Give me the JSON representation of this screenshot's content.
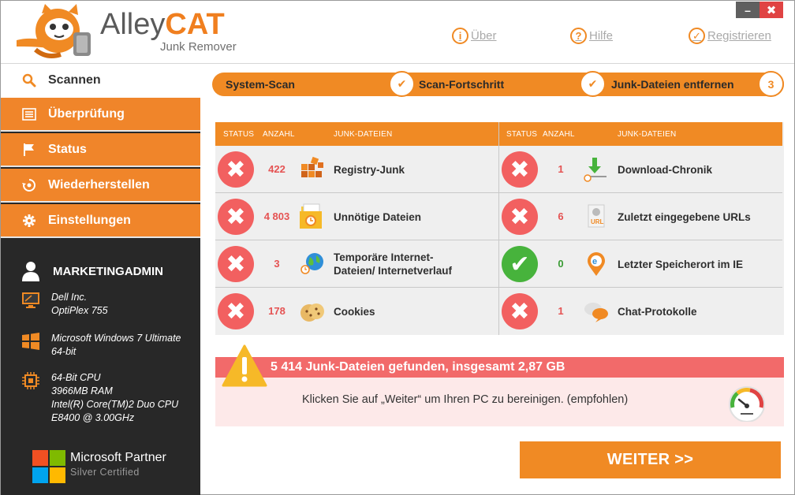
{
  "app": {
    "brand_part1": "Alley",
    "brand_part2": "CAT",
    "subtitle": "Junk Remover"
  },
  "header_links": {
    "about": "Über",
    "help": "Hilfe",
    "register": "Registrieren"
  },
  "window_controls": {
    "minimize": "–",
    "close": "✖"
  },
  "sidebar": {
    "items": [
      {
        "label": "Scannen",
        "icon": "search-icon",
        "active": true
      },
      {
        "label": "Überprüfung",
        "icon": "list-icon",
        "active": false
      },
      {
        "label": "Status",
        "icon": "flag-icon",
        "active": false
      },
      {
        "label": "Wiederherstellen",
        "icon": "restore-icon",
        "active": false
      },
      {
        "label": "Einstellungen",
        "icon": "gear-icon",
        "active": false
      }
    ],
    "user": "MARKETINGADMIN",
    "system": {
      "pc_line1": "Dell Inc.",
      "pc_line2": "OptiPlex 755",
      "os_line1": "Microsoft Windows 7 Ultimate",
      "os_line2": "64-bit",
      "cpu_line1": "64-Bit CPU",
      "cpu_line2": "3966MB RAM",
      "cpu_line3": "Intel(R) Core(TM)2 Duo CPU",
      "cpu_line4": "E8400  @ 3.00GHz"
    },
    "partner": {
      "title": "Microsoft Partner",
      "sub": "Silver Certified"
    }
  },
  "steps": {
    "step1": "System-Scan",
    "step2": "Scan-Fortschritt",
    "step3": "Junk-Dateien entfernen",
    "step3_number": "3"
  },
  "table": {
    "headers": {
      "status": "STATUS",
      "count": "ANZAHL",
      "files": "JUNK-DATEIEN"
    },
    "left": [
      {
        "count": "422",
        "label": "Registry-Junk",
        "ok": false,
        "icon": "registry-icon"
      },
      {
        "count": "4 803",
        "label": "Unnötige Dateien",
        "ok": false,
        "icon": "folder-clock-icon"
      },
      {
        "count": "3",
        "label_line1": "Temporäre Internet-",
        "label_line2": "Dateien/ Internetverlauf",
        "ok": false,
        "icon": "globe-icon"
      },
      {
        "count": "178",
        "label": "Cookies",
        "ok": false,
        "icon": "cookie-icon"
      }
    ],
    "right": [
      {
        "count": "1",
        "label": "Download-Chronik",
        "ok": false,
        "icon": "download-icon"
      },
      {
        "count": "6",
        "label": "Zuletzt eingegebene URLs",
        "ok": false,
        "icon": "url-icon",
        "icon_text": "URL"
      },
      {
        "count": "0",
        "label": "Letzter Speicherort im IE",
        "ok": true,
        "icon": "ie-location-icon"
      },
      {
        "count": "1",
        "label": "Chat-Protokolle",
        "ok": false,
        "icon": "chat-icon"
      }
    ]
  },
  "summary": {
    "title": "5 414 Junk-Dateien gefunden, insgesamt 2,87 GB",
    "text": "Klicken Sie auf „Weiter“ um Ihren PC zu bereinigen. (empfohlen)"
  },
  "next_button": "WEITER >>",
  "colors": {
    "accent": "#f08a24",
    "danger": "#f26060",
    "ok": "#47b33c",
    "sidebar_bg": "#282828"
  }
}
